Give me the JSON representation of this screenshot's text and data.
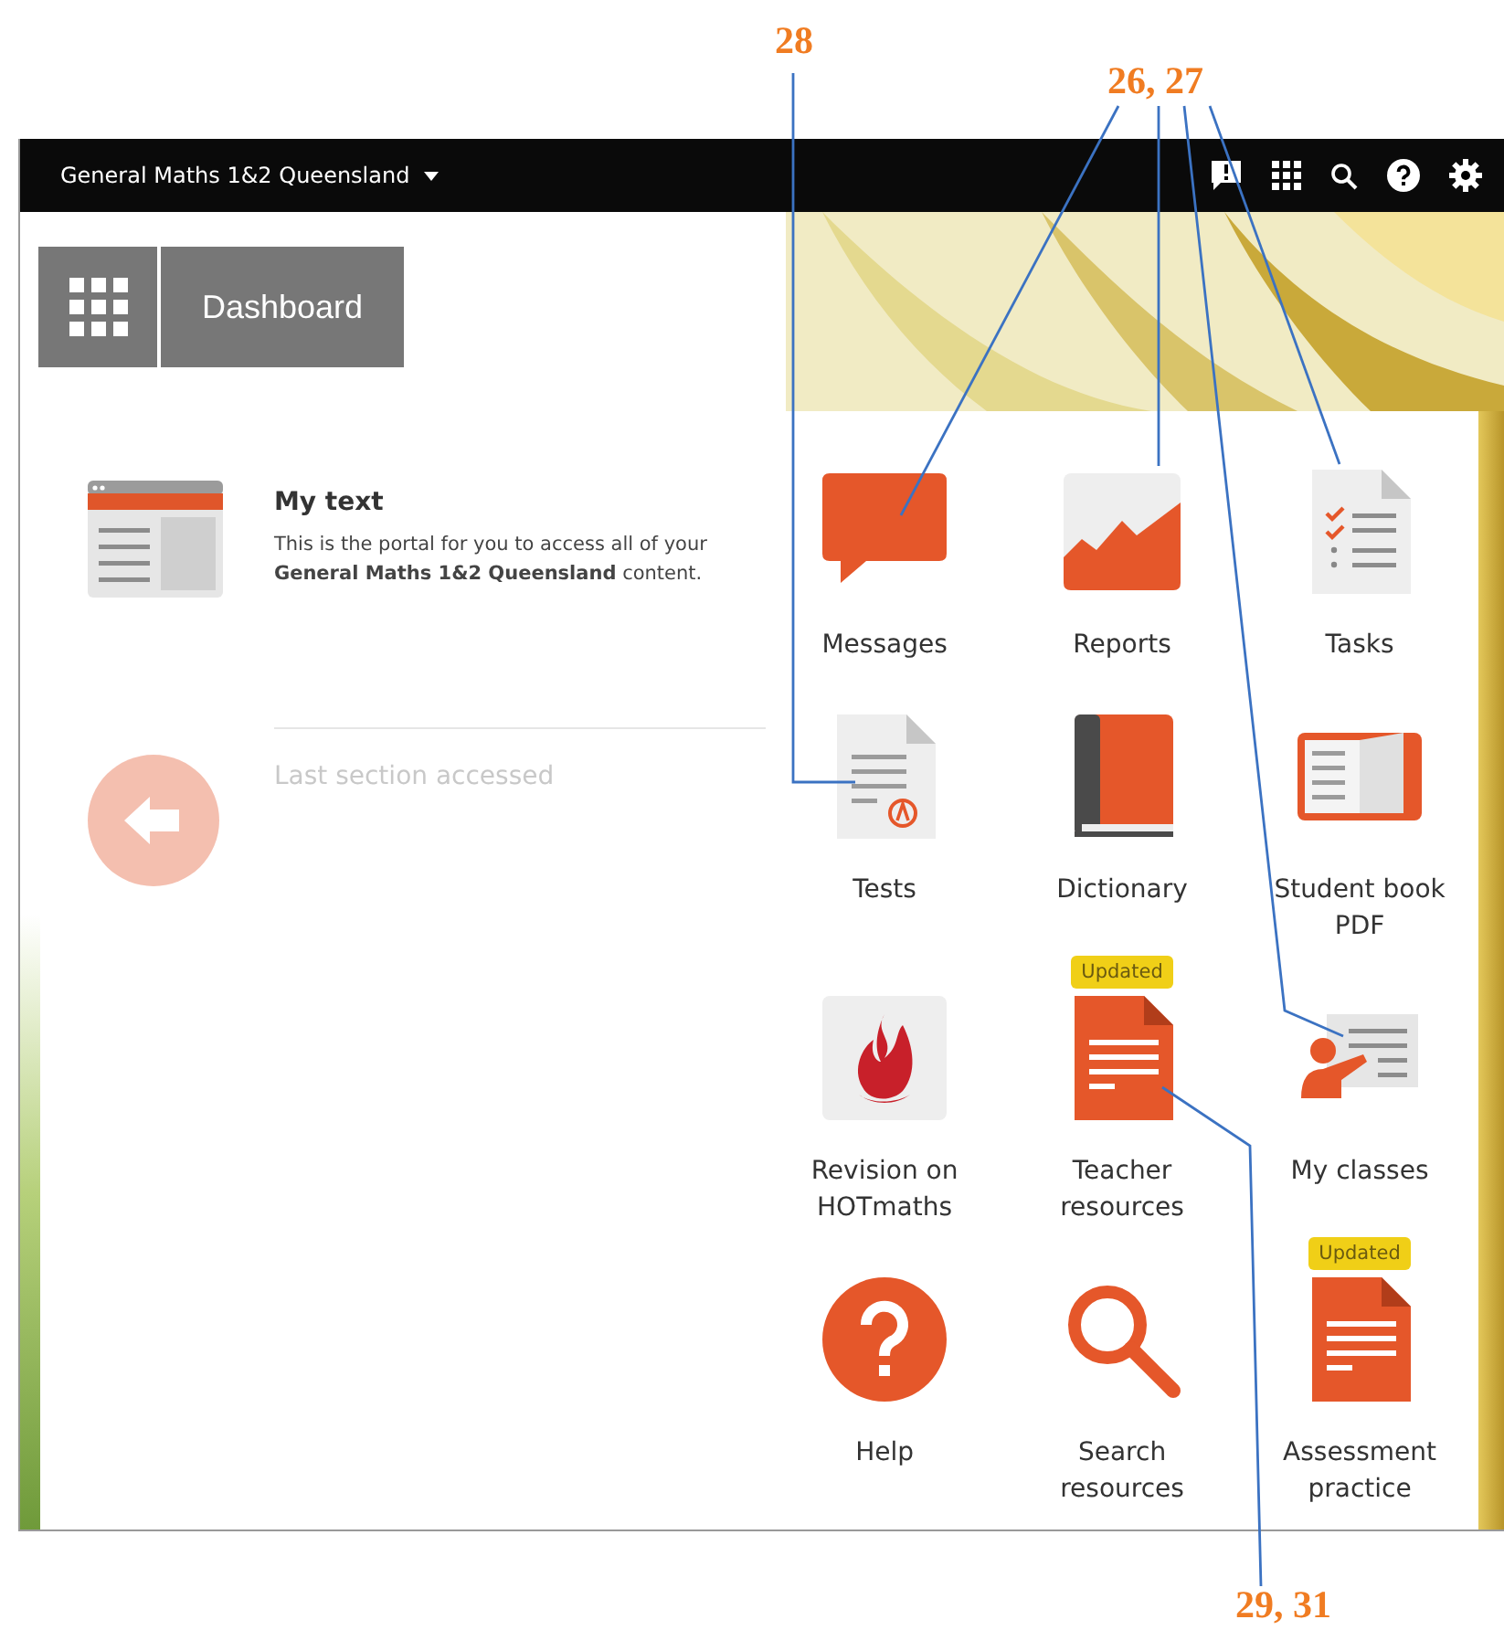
{
  "callouts": [
    {
      "label": "28"
    },
    {
      "label": "26, 27"
    },
    {
      "label": "29, 31"
    }
  ],
  "topbar": {
    "title": "General Maths 1&2 Queensland"
  },
  "dashboard": {
    "label": "Dashboard"
  },
  "my_text": {
    "title": "My text",
    "description": "This is the portal for you to access all of your **General Maths 1&2 Queensland** content."
  },
  "last_section": {
    "label": "Last section accessed",
    "disabled": true
  },
  "tiles": [
    {
      "label": "Messages"
    },
    {
      "label": "Reports"
    },
    {
      "label": "Tasks"
    },
    {
      "label": "Tests"
    },
    {
      "label": "Dictionary"
    },
    {
      "label": "Student book PDF"
    },
    {
      "label": "Revision on HOTmaths"
    },
    {
      "label": "Teacher resources",
      "badge": "Updated"
    },
    {
      "label": "My classes"
    },
    {
      "label": "Help"
    },
    {
      "label": "Search resources"
    },
    {
      "label": "Assessment practice",
      "badge": "Updated"
    }
  ]
}
